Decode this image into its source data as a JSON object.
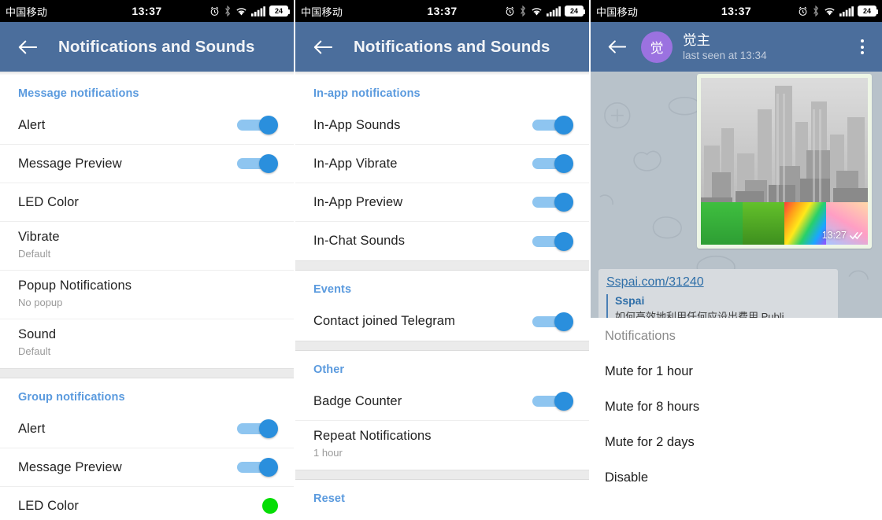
{
  "statusbar": {
    "carrier": "中国移动",
    "time": "13:37",
    "battery_level": "24",
    "icons": [
      "alarm-icon",
      "bluetooth-icon",
      "wifi-icon",
      "signal-icon",
      "battery-icon"
    ]
  },
  "colors": {
    "appbar": "#4b6e9c",
    "accent_blue": "#5a9ade",
    "toggle_thumb": "#2a8fdd",
    "toggle_track": "#8ec5f0",
    "led_green": "#05dd05",
    "avatar_purple": "#9b72e0",
    "chat_bg": "#b8c2ca",
    "bubble_bg": "#eef6e6"
  },
  "screen1": {
    "title": "Notifications and Sounds",
    "back_label": "back",
    "sections": [
      {
        "header": "Message notifications",
        "rows": [
          {
            "label": "Alert",
            "control": "toggle",
            "on": true
          },
          {
            "label": "Message Preview",
            "control": "toggle",
            "on": true
          },
          {
            "label": "LED Color",
            "control": "none"
          },
          {
            "label": "Vibrate",
            "sub": "Default",
            "control": "none"
          },
          {
            "label": "Popup Notifications",
            "sub": "No popup",
            "control": "none"
          },
          {
            "label": "Sound",
            "sub": "Default",
            "control": "none"
          }
        ]
      },
      {
        "header": "Group notifications",
        "rows": [
          {
            "label": "Alert",
            "control": "toggle",
            "on": true
          },
          {
            "label": "Message Preview",
            "control": "toggle",
            "on": true
          },
          {
            "label": "LED Color",
            "control": "led"
          }
        ]
      }
    ]
  },
  "screen2": {
    "title": "Notifications and Sounds",
    "back_label": "back",
    "sections": [
      {
        "header": "In-app notifications",
        "rows": [
          {
            "label": "In-App Sounds",
            "control": "toggle",
            "on": true
          },
          {
            "label": "In-App Vibrate",
            "control": "toggle",
            "on": true
          },
          {
            "label": "In-App Preview",
            "control": "toggle",
            "on": true
          },
          {
            "label": "In-Chat Sounds",
            "control": "toggle",
            "on": true
          }
        ]
      },
      {
        "header": "Events",
        "rows": [
          {
            "label": "Contact joined Telegram",
            "control": "toggle",
            "on": true
          }
        ]
      },
      {
        "header": "Other",
        "rows": [
          {
            "label": "Badge Counter",
            "control": "toggle",
            "on": true
          },
          {
            "label": "Repeat Notifications",
            "sub": "1 hour",
            "control": "none"
          }
        ]
      },
      {
        "header": "Reset",
        "rows": []
      }
    ]
  },
  "screen3": {
    "contact_name": "觉主",
    "contact_status": "last seen at 13:34",
    "avatar_initial": "觉",
    "back_label": "back",
    "menu_label": "more options",
    "message": {
      "time": "13:27",
      "read_state": "read"
    },
    "link_preview": {
      "url": "Sspai.com/31240",
      "site": "Sspai",
      "description": "如何高效地利用任何应设出费用 Publi..."
    },
    "dialog": {
      "title": "Notifications",
      "options": [
        "Mute for 1 hour",
        "Mute for 8 hours",
        "Mute for 2 days",
        "Disable"
      ]
    }
  }
}
